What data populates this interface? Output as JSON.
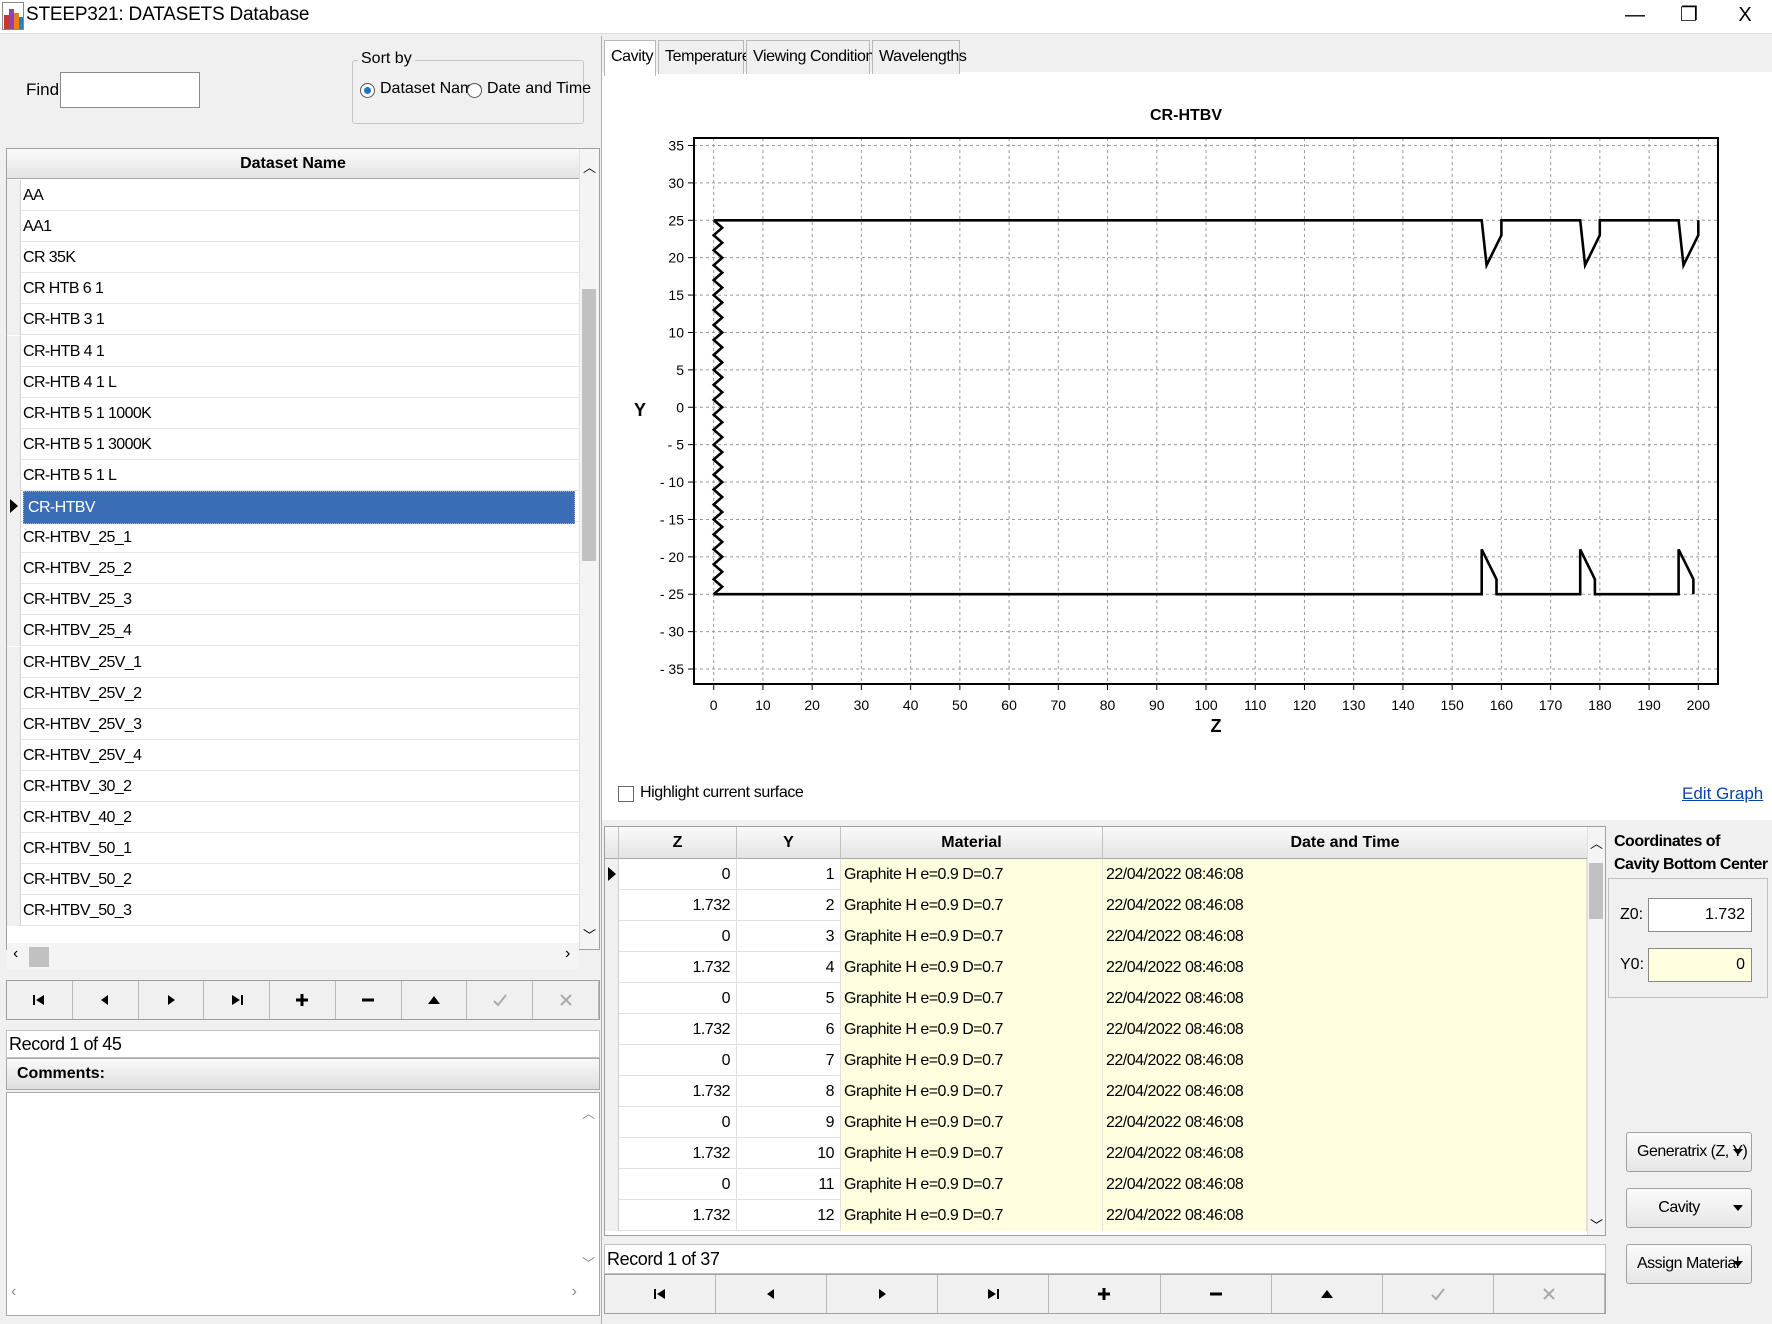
{
  "window": {
    "title": "STEEP321: DATASETS Database",
    "controls": {
      "minimize": "—",
      "restore": "❐",
      "close": "X"
    }
  },
  "find": {
    "label": "Find:",
    "value": ""
  },
  "sort_by": {
    "legend": "Sort by",
    "options": [
      {
        "label": "Dataset Name",
        "selected": true
      },
      {
        "label": "Date and Time",
        "selected": false
      }
    ]
  },
  "datasets": {
    "header": "Dataset Name",
    "selected_index": 10,
    "items": [
      "AA",
      "AA1",
      "CR 35K",
      "CR HTB 6 1",
      "CR-HTB 3 1",
      "CR-HTB 4 1",
      "CR-HTB 4 1 L",
      "CR-HTB 5 1 1000K",
      "CR-HTB 5 1 3000K",
      "CR-HTB 5 1 L",
      "CR-HTBV",
      "CR-HTBV_25_1",
      "CR-HTBV_25_2",
      "CR-HTBV_25_3",
      "CR-HTBV_25_4",
      "CR-HTBV_25V_1",
      "CR-HTBV_25V_2",
      "CR-HTBV_25V_3",
      "CR-HTBV_25V_4",
      "CR-HTBV_30_2",
      "CR-HTBV_40_2",
      "CR-HTBV_50_1",
      "CR-HTBV_50_2",
      "CR-HTBV_50_3"
    ],
    "record_label": "Record 1 of 45"
  },
  "nav_icons": [
    "first-icon",
    "prev-icon",
    "next-icon",
    "last-icon",
    "add-icon",
    "delete-icon",
    "edit-icon",
    "post-icon",
    "cancel-icon"
  ],
  "comments": {
    "label": "Comments:",
    "value": ""
  },
  "tabs": [
    "Cavity",
    "Temperatures",
    "Viewing Conditions",
    "Wavelengths"
  ],
  "active_tab": 0,
  "chart_data": {
    "type": "line",
    "title": "CR-HTBV",
    "xlabel": "Z",
    "ylabel": "Y",
    "xlim": [
      -4,
      204
    ],
    "ylim": [
      -37,
      36
    ],
    "x_ticks": [
      0,
      10,
      20,
      30,
      40,
      50,
      60,
      70,
      80,
      90,
      100,
      110,
      120,
      130,
      140,
      150,
      160,
      170,
      180,
      190,
      200
    ],
    "y_ticks": [
      35,
      30,
      25,
      20,
      15,
      10,
      5,
      0,
      -5,
      -10,
      -15,
      -20,
      -25,
      -30,
      -35
    ],
    "y_tick_labels": [
      "35",
      "30",
      "25",
      "20",
      "15",
      "10",
      "5",
      "0",
      "- 5",
      "- 10",
      "- 15",
      "- 20",
      "- 25",
      "- 30",
      "- 35"
    ],
    "grid": true,
    "series": [
      {
        "points": [
          [
            0,
            25
          ],
          [
            156,
            25
          ],
          [
            157,
            19
          ],
          [
            160,
            23
          ],
          [
            160,
            25
          ],
          [
            176,
            25
          ],
          [
            177,
            19
          ],
          [
            180,
            23
          ],
          [
            180,
            25
          ],
          [
            196,
            25
          ],
          [
            197,
            19
          ],
          [
            200,
            23
          ],
          [
            200,
            25
          ]
        ]
      },
      {
        "points": [
          [
            0,
            -25
          ],
          [
            156,
            -25
          ],
          [
            156,
            -19
          ],
          [
            159,
            -23
          ],
          [
            159,
            -25
          ],
          [
            176,
            -25
          ],
          [
            176,
            -19
          ],
          [
            179,
            -23
          ],
          [
            179,
            -25
          ],
          [
            196,
            -25
          ],
          [
            196,
            -19
          ],
          [
            199,
            -23
          ],
          [
            199,
            -25
          ]
        ]
      },
      {
        "style": "zigzag",
        "z_alternating": [
          0,
          1.732
        ],
        "y_from": -25,
        "y_to": 25,
        "y_step": 1
      }
    ]
  },
  "highlight": {
    "label": "Highlight current surface",
    "checked": false
  },
  "edit_graph": "Edit Graph",
  "surfaces": {
    "columns": [
      "Z",
      "Y",
      "Material",
      "Date and Time"
    ],
    "rows": [
      {
        "z": "0",
        "y": "1",
        "material": "Graphite H e=0.9 D=0.7",
        "datetime": "22/04/2022 08:46:08"
      },
      {
        "z": "1.732",
        "y": "2",
        "material": "Graphite H e=0.9 D=0.7",
        "datetime": "22/04/2022 08:46:08"
      },
      {
        "z": "0",
        "y": "3",
        "material": "Graphite H e=0.9 D=0.7",
        "datetime": "22/04/2022 08:46:08"
      },
      {
        "z": "1.732",
        "y": "4",
        "material": "Graphite H e=0.9 D=0.7",
        "datetime": "22/04/2022 08:46:08"
      },
      {
        "z": "0",
        "y": "5",
        "material": "Graphite H e=0.9 D=0.7",
        "datetime": "22/04/2022 08:46:08"
      },
      {
        "z": "1.732",
        "y": "6",
        "material": "Graphite H e=0.9 D=0.7",
        "datetime": "22/04/2022 08:46:08"
      },
      {
        "z": "0",
        "y": "7",
        "material": "Graphite H e=0.9 D=0.7",
        "datetime": "22/04/2022 08:46:08"
      },
      {
        "z": "1.732",
        "y": "8",
        "material": "Graphite H e=0.9 D=0.7",
        "datetime": "22/04/2022 08:46:08"
      },
      {
        "z": "0",
        "y": "9",
        "material": "Graphite H e=0.9 D=0.7",
        "datetime": "22/04/2022 08:46:08"
      },
      {
        "z": "1.732",
        "y": "10",
        "material": "Graphite H e=0.9 D=0.7",
        "datetime": "22/04/2022 08:46:08"
      },
      {
        "z": "0",
        "y": "11",
        "material": "Graphite H e=0.9 D=0.7",
        "datetime": "22/04/2022 08:46:08"
      },
      {
        "z": "1.732",
        "y": "12",
        "material": "Graphite H e=0.9 D=0.7",
        "datetime": "22/04/2022 08:46:08"
      }
    ],
    "record_label": "Record 1 of 37"
  },
  "coordinates": {
    "title_line1": "Coordinates of",
    "title_line2": "Cavity Bottom Center",
    "z0_label": "Z0:",
    "z0_value": "1.732",
    "y0_label": "Y0:",
    "y0_value": "0"
  },
  "dropdowns": [
    "Generatrix (Z, Y)",
    "Cavity",
    "Assign Material"
  ],
  "colors": {
    "selection": "#3a6db5",
    "yellow_cell": "#ffffe0",
    "link": "#0645ad"
  }
}
